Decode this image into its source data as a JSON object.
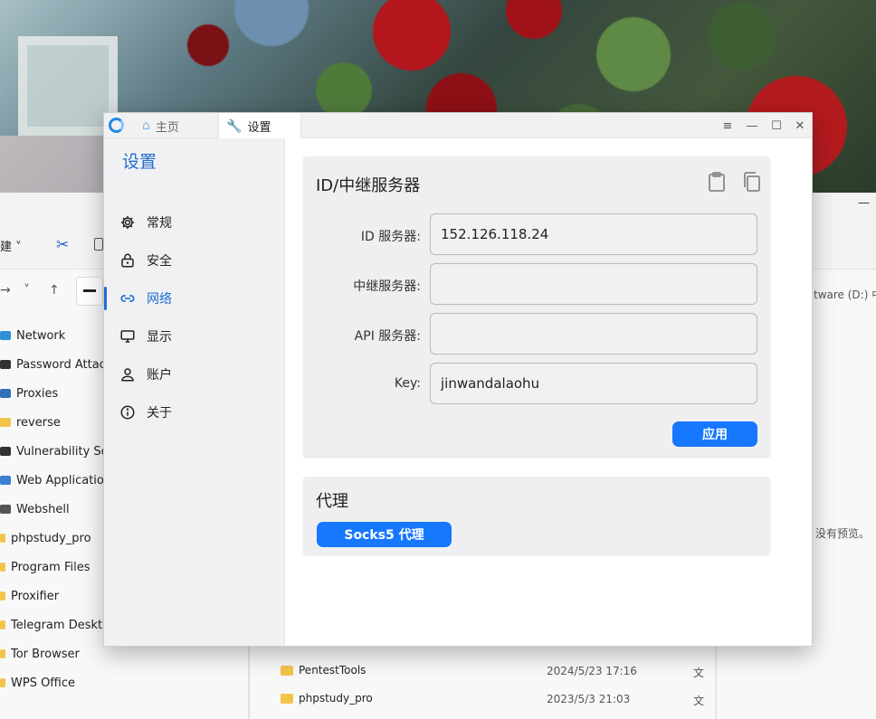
{
  "explorer": {
    "new_label": "建 ˅",
    "path_fragment": "tware (D:) 中",
    "sidebar_items": [
      {
        "label": "Network",
        "icon": "monitor-icon",
        "color": "#2f8fd8"
      },
      {
        "label": "Password Attack",
        "icon": "person-lock-icon",
        "color": "#333333"
      },
      {
        "label": "Proxies",
        "icon": "network-icon",
        "color": "#2f6fb8"
      },
      {
        "label": "reverse",
        "icon": "folder-icon",
        "color": "#f2c44b"
      },
      {
        "label": "Vulnerability Sca",
        "icon": "spy-icon",
        "color": "#333333"
      },
      {
        "label": "Web Application",
        "icon": "webapp-icon",
        "color": "#3a7fd0"
      },
      {
        "label": "Webshell",
        "icon": "terminal-icon",
        "color": "#555555"
      },
      {
        "label": "phpstudy_pro",
        "icon": "folder-icon",
        "color": "#f2c44b"
      },
      {
        "label": "Program Files",
        "icon": "folder-icon",
        "color": "#f2c44b"
      },
      {
        "label": "Proxifier",
        "icon": "folder-icon",
        "color": "#f2c44b"
      },
      {
        "label": "Telegram Desktop",
        "icon": "folder-icon",
        "color": "#f2c44b"
      },
      {
        "label": "Tor Browser",
        "icon": "folder-icon",
        "color": "#f2c44b"
      },
      {
        "label": "WPS Office",
        "icon": "folder-icon",
        "color": "#f2c44b"
      }
    ],
    "files": [
      {
        "name": "PentestTools",
        "date": "2024/5/23 17:16",
        "type": "文"
      },
      {
        "name": "phpstudy_pro",
        "date": "2023/5/3 21:03",
        "type": "文"
      }
    ],
    "preview_text": "没有预览。"
  },
  "app": {
    "tabs": [
      {
        "label": "主页",
        "icon": "home-icon"
      },
      {
        "label": "设置",
        "icon": "wrench-icon"
      }
    ],
    "window_controls": [
      "≡",
      "—",
      "☐",
      "✕"
    ],
    "sidebar": {
      "title": "设置",
      "items": [
        {
          "label": "常规",
          "icon": "gear-icon"
        },
        {
          "label": "安全",
          "icon": "lock-icon"
        },
        {
          "label": "网络",
          "icon": "link-icon",
          "active": true
        },
        {
          "label": "显示",
          "icon": "monitor-icon"
        },
        {
          "label": "账户",
          "icon": "person-icon"
        },
        {
          "label": "关于",
          "icon": "info-icon"
        }
      ]
    },
    "server_card": {
      "title": "ID/中继服务器",
      "fields": [
        {
          "label": "ID 服务器:",
          "value": "152.126.118.24"
        },
        {
          "label": "中继服务器:",
          "value": ""
        },
        {
          "label": "API 服务器:",
          "value": ""
        },
        {
          "label": "Key:",
          "value": "jinwandalaohu"
        }
      ],
      "apply_label": "应用"
    },
    "proxy_card": {
      "title": "代理",
      "socks_label": "Socks5 代理"
    },
    "accent_color": "#1677ff"
  }
}
